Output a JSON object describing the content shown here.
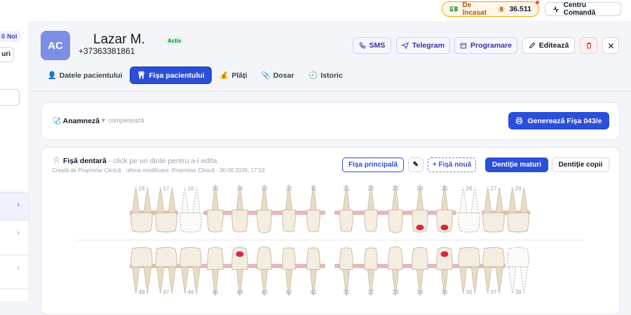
{
  "topbar": {
    "cash_label": "De încasat",
    "cash_count": "8",
    "cash_amount": "36.511",
    "command_label": "Centru Comandă"
  },
  "left_panel": {
    "new_count": "0",
    "new_label": "Noi",
    "button_label": "uri"
  },
  "patient": {
    "initials": "AC",
    "name": "Lazar M.",
    "phone": "+37363381861",
    "status": "Activ"
  },
  "actions": {
    "sms": "SMS",
    "telegram": "Telegram",
    "appointment": "Programare",
    "edit": "Editează"
  },
  "tabs": [
    {
      "label": "Datele pacientului",
      "icon": "👤"
    },
    {
      "label": "Fișa pacientului",
      "icon": "🦷"
    },
    {
      "label": "Plăți",
      "icon": "💰"
    },
    {
      "label": "Dosar",
      "icon": "📎"
    },
    {
      "label": "Istoric",
      "icon": "🕘"
    }
  ],
  "anamnesis": {
    "icon": "🩺",
    "title": "Anamneză",
    "toggle": "▼ completează",
    "generate_button": "Generează Fișa 043/e"
  },
  "dental": {
    "icon": "🦷",
    "title": "Fișă dentară",
    "hint": "· click pe un dinte pentru a-l edita",
    "meta": "Creată de Proprietar Clinică · ultima modificare: Proprietar Clinică · 30.08.2026, 17:53",
    "main_chart": "Fișa principală",
    "pencil": "✎",
    "new_chart": "+ Fișă nouă",
    "adult": "Dentiție maturi",
    "child": "Dentiție copii"
  },
  "chart_data": {
    "upper_teeth": [
      {
        "n": "18",
        "type": "molar",
        "status": "normal",
        "bridge": true
      },
      {
        "n": "17",
        "type": "molar",
        "status": "normal",
        "bridge": true
      },
      {
        "n": "16",
        "type": "molar",
        "status": "missing",
        "bridge": false
      },
      {
        "n": "15",
        "type": "premolar",
        "status": "normal",
        "bridge": true
      },
      {
        "n": "14",
        "type": "premolar",
        "status": "normal",
        "bridge": true
      },
      {
        "n": "13",
        "type": "canine",
        "status": "normal",
        "bridge": true
      },
      {
        "n": "12",
        "type": "incisor",
        "status": "normal",
        "bridge": true
      },
      {
        "n": "11",
        "type": "incisor",
        "status": "normal",
        "bridge": true
      },
      {
        "n": "21",
        "type": "incisor",
        "status": "normal",
        "bridge": true
      },
      {
        "n": "22",
        "type": "incisor",
        "status": "normal",
        "bridge": true
      },
      {
        "n": "23",
        "type": "canine",
        "status": "normal",
        "bridge": true
      },
      {
        "n": "24",
        "type": "premolar",
        "status": "caries",
        "bridge": true
      },
      {
        "n": "25",
        "type": "premolar",
        "status": "caries",
        "bridge": true
      },
      {
        "n": "26",
        "type": "molar",
        "status": "missing",
        "bridge": false
      },
      {
        "n": "27",
        "type": "molar",
        "status": "normal",
        "bridge": true
      },
      {
        "n": "28",
        "type": "molar",
        "status": "normal",
        "bridge": true
      }
    ],
    "lower_teeth": [
      {
        "n": "48",
        "type": "molar",
        "status": "normal",
        "bridge": true
      },
      {
        "n": "47",
        "type": "molar",
        "status": "normal",
        "bridge": true
      },
      {
        "n": "46",
        "type": "molar",
        "status": "normal",
        "bridge": true
      },
      {
        "n": "45",
        "type": "premolar",
        "status": "normal",
        "bridge": true
      },
      {
        "n": "44",
        "type": "premolar",
        "status": "caries",
        "bridge": true
      },
      {
        "n": "43",
        "type": "canine",
        "status": "normal",
        "bridge": true
      },
      {
        "n": "42",
        "type": "incisor",
        "status": "normal",
        "bridge": true
      },
      {
        "n": "41",
        "type": "incisor",
        "status": "normal",
        "bridge": true
      },
      {
        "n": "31",
        "type": "incisor",
        "status": "normal",
        "bridge": true
      },
      {
        "n": "32",
        "type": "incisor",
        "status": "normal",
        "bridge": true
      },
      {
        "n": "33",
        "type": "canine",
        "status": "normal",
        "bridge": true
      },
      {
        "n": "34",
        "type": "premolar",
        "status": "normal",
        "bridge": true
      },
      {
        "n": "35",
        "type": "premolar",
        "status": "caries",
        "bridge": true
      },
      {
        "n": "36",
        "type": "molar",
        "status": "normal",
        "bridge": true
      },
      {
        "n": "37",
        "type": "molar",
        "status": "normal",
        "bridge": true
      },
      {
        "n": "38",
        "type": "molar",
        "status": "missing",
        "bridge": false
      }
    ],
    "colors": {
      "tooth": "#f4ede1",
      "root": "#e8dcc6",
      "bridge": "#e8b8b8",
      "caries": "#d62839",
      "missing": "#9ca3af"
    }
  }
}
